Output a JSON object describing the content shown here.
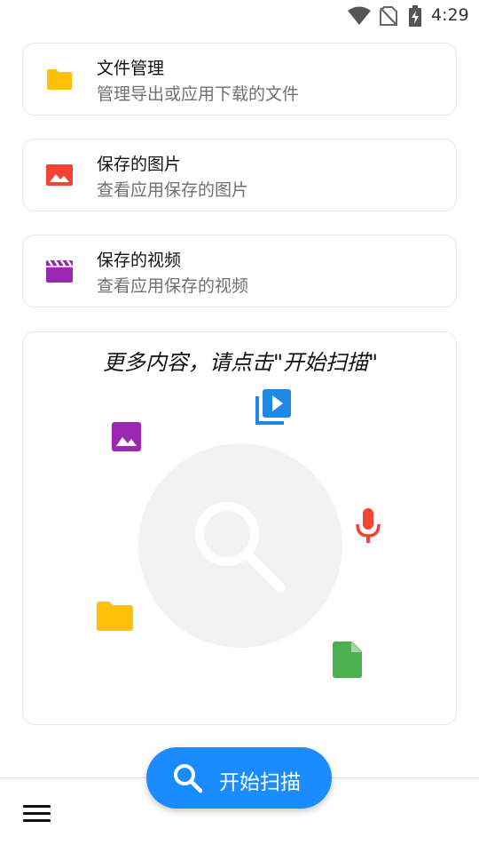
{
  "status_bar": {
    "time": "4:29",
    "icons": [
      "wifi-icon",
      "no-sim-icon",
      "battery-charging-icon"
    ]
  },
  "cards": [
    {
      "title": "文件管理",
      "subtitle": "管理导出或应用下载的文件",
      "icon": "folder-icon",
      "icon_color": "#FFC107"
    },
    {
      "title": "保存的图片",
      "subtitle": "查看应用保存的图片",
      "icon": "image-icon",
      "icon_color": "#F44336"
    },
    {
      "title": "保存的视频",
      "subtitle": "查看应用保存的视频",
      "icon": "video-icon",
      "icon_color": "#9C27B0"
    }
  ],
  "scan_panel": {
    "heading": "更多内容，请点击\"开始扫描\"",
    "icons": [
      {
        "name": "video-library-icon",
        "color": "#1E88E5"
      },
      {
        "name": "image-icon",
        "color": "#9C27B0"
      },
      {
        "name": "microphone-icon",
        "color": "#F44336"
      },
      {
        "name": "folder-icon",
        "color": "#FFC107"
      },
      {
        "name": "file-icon",
        "color": "#4CAF50"
      },
      {
        "name": "search-icon",
        "color": "#FFFFFF"
      }
    ]
  },
  "bottom_bar": {
    "menu_icon": "hamburger-menu-icon",
    "scan_button_label": "开始扫描",
    "scan_button_color": "#1A8CFF"
  }
}
